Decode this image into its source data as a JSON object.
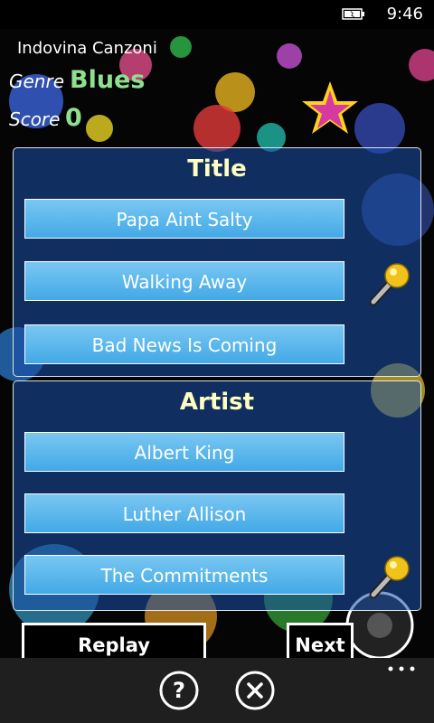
{
  "status": {
    "time": "9:46",
    "battery_icon": "battery-charging-icon"
  },
  "app_title": "Indovina Canzoni",
  "genre": {
    "label": "Genre",
    "value": "Blues"
  },
  "score": {
    "label": "Score",
    "value": "0"
  },
  "title_panel": {
    "heading": "Title",
    "choices": [
      "Papa Aint Salty",
      "Walking Away",
      "Bad News Is Coming"
    ]
  },
  "artist_panel": {
    "heading": "Artist",
    "choices": [
      "Albert King",
      "Luther Allison",
      "The Commitments"
    ]
  },
  "buttons": {
    "replay": "Replay",
    "next": "Next"
  },
  "appbar": {
    "icons": [
      "help-icon",
      "close-icon",
      "more-icon"
    ]
  },
  "colors": {
    "accent_green": "#8ee08e",
    "heading_yellow": "#ffffc0",
    "choice_blue": "#5bb7ec"
  }
}
